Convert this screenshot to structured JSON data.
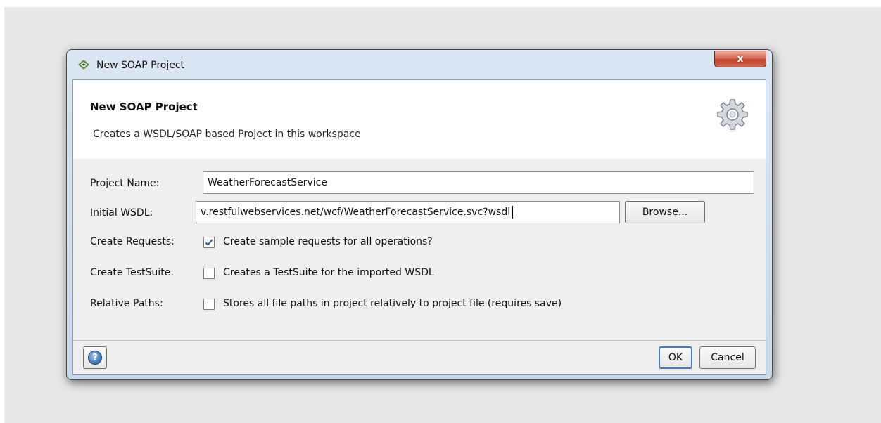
{
  "window": {
    "title": "New SOAP Project",
    "close_label": "x"
  },
  "header": {
    "title": "New SOAP Project",
    "description": "Creates a WSDL/SOAP based Project in this workspace",
    "icon": "gear-icon"
  },
  "form": {
    "project_name": {
      "label": "Project Name:",
      "value": "WeatherForecastService"
    },
    "initial_wsdl": {
      "label": "Initial WSDL:",
      "value": "v.restfulwebservices.net/wcf/WeatherForecastService.svc?wsdl",
      "browse_label": "Browse..."
    },
    "create_requests": {
      "label": "Create Requests:",
      "checked": true,
      "text": "Create sample requests for all operations?"
    },
    "create_testsuite": {
      "label": "Create TestSuite:",
      "checked": false,
      "text": "Creates a TestSuite for the imported WSDL"
    },
    "relative_paths": {
      "label": "Relative Paths:",
      "checked": false,
      "text": "Stores all file paths in project relatively to project file (requires save)"
    }
  },
  "footer": {
    "help_icon": "help-icon",
    "help_glyph": "?",
    "ok_label": "OK",
    "cancel_label": "Cancel"
  },
  "colors": {
    "close_button": "#c2432c",
    "title_gradient": "#c9d8ea",
    "checkbox_check": "#2c5890"
  }
}
